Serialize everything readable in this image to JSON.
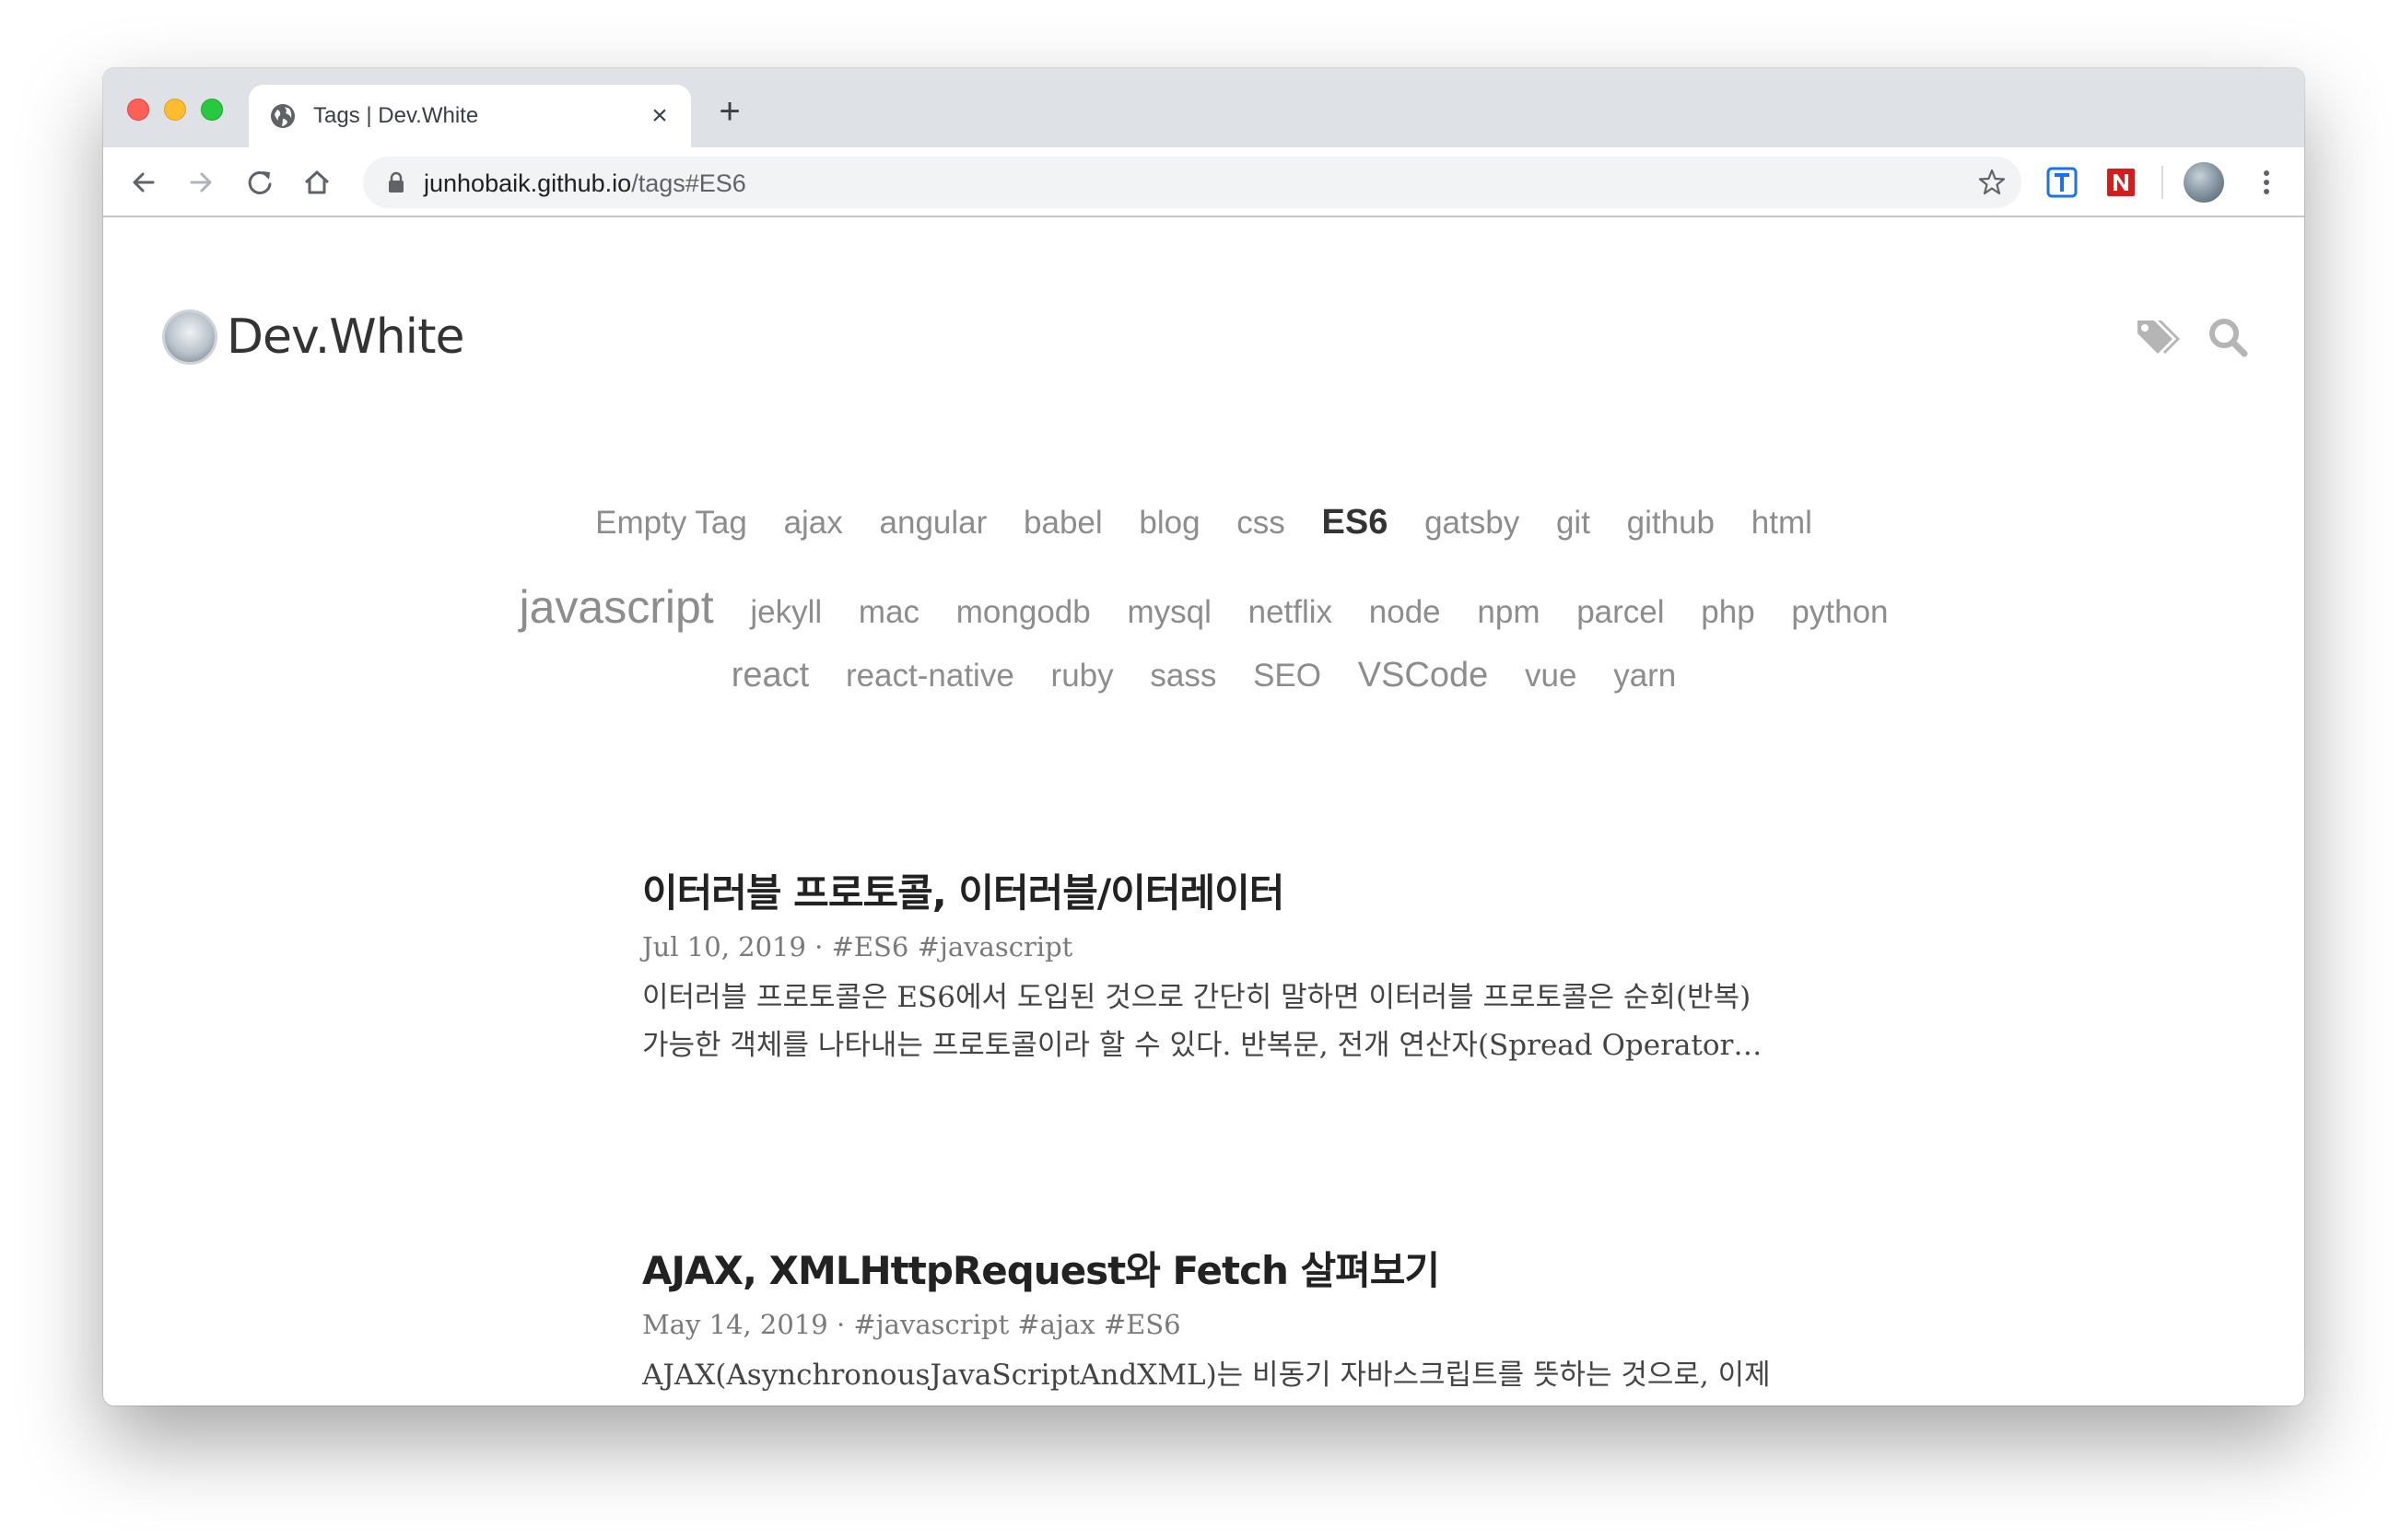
{
  "browser": {
    "tab": {
      "title": "Tags | Dev.White",
      "favicon": "globe-icon"
    },
    "new_tab_symbol": "+",
    "address": {
      "host": "junhobaik.github.io",
      "path": "/tags#ES6"
    },
    "extensions": [
      "translate-extension-icon",
      "naver-extension-icon"
    ]
  },
  "site": {
    "title": "Dev.White",
    "header_icons": [
      "tags-icon",
      "search-icon"
    ]
  },
  "tags": {
    "row1": [
      "Empty Tag",
      "ajax",
      "angular",
      "babel",
      "blog",
      "css",
      "ES6",
      "gatsby",
      "git",
      "github",
      "html"
    ],
    "row2": [
      "javascript",
      "jekyll",
      "mac",
      "mongodb",
      "mysql",
      "netflix",
      "node",
      "npm",
      "parcel",
      "php",
      "python"
    ],
    "row3": [
      "react",
      "react-native",
      "ruby",
      "sass",
      "SEO",
      "VSCode",
      "vue",
      "yarn"
    ],
    "active": "ES6"
  },
  "posts": [
    {
      "title": "이터러블 프로토콜, 이터러블/이터레이터",
      "meta": "Jul 10, 2019 · #ES6  #javascript",
      "excerpt": "이터러블 프로토콜은 ES6에서 도입된 것으로 간단히 말하면 이터러블 프로토콜은 순회(반복) 가능한 객체를 나타내는 프로토콜이라 할 수 있다. 반복문, 전개 연산자(Spread Operator…"
    },
    {
      "title": "AJAX, XMLHttpRequest와 Fetch 살펴보기",
      "meta": "May 14, 2019 · #javascript  #ajax  #ES6",
      "excerpt": "AJAX(AsynchronousJavaScriptAndXML)는 비동기 자바스크립트를 뜻하는 것으로, 이제는 비동기적 자바스크립트 동작을 하는 기술들을 통들어서도 AJAX라고 부릅니다. 최초로…"
    }
  ],
  "colors": {
    "tab_strip": "#dee1e6",
    "omnibox": "#f1f3f4",
    "tag_text": "#8d8d8d",
    "active_tag": "#333333"
  }
}
